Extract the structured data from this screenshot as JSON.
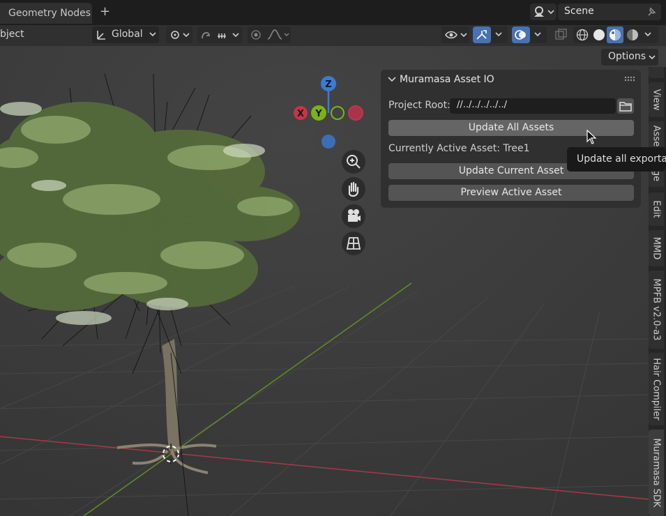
{
  "top_bar": {
    "tab_label": "Geometry Nodes",
    "add_tab_symbol": "+",
    "scene_label": "Scene"
  },
  "header": {
    "left_text": "bject",
    "transform_orientation": "Global"
  },
  "viewport": {
    "options_label": "Options",
    "gizmo": {
      "z": "Z",
      "y": "Y",
      "x": "X"
    }
  },
  "panel": {
    "title": "Muramasa Asset IO",
    "project_root_label": "Project Root:",
    "project_root_value": "//../../../../../",
    "update_all_label": "Update All Assets",
    "active_asset_text": "Currently Active Asset: Tree1",
    "update_current_label": "Update Current Asset",
    "preview_label": "Preview Active Asset",
    "tooltip": "Update all exportab"
  },
  "sidebar_tabs": [
    {
      "label": "View"
    },
    {
      "label": "Asse"
    },
    {
      "label": "ge"
    },
    {
      "label": "Edit"
    },
    {
      "label": "MMD"
    },
    {
      "label": "MPFB v2.0-a3"
    },
    {
      "label": "Hair Compiler"
    },
    {
      "label": "Muramasa SDK"
    }
  ],
  "colors": {
    "accent": "#4772b3",
    "axis_x": "#c8334a",
    "axis_y": "#7ab317",
    "axis_z": "#3b7bd6"
  }
}
